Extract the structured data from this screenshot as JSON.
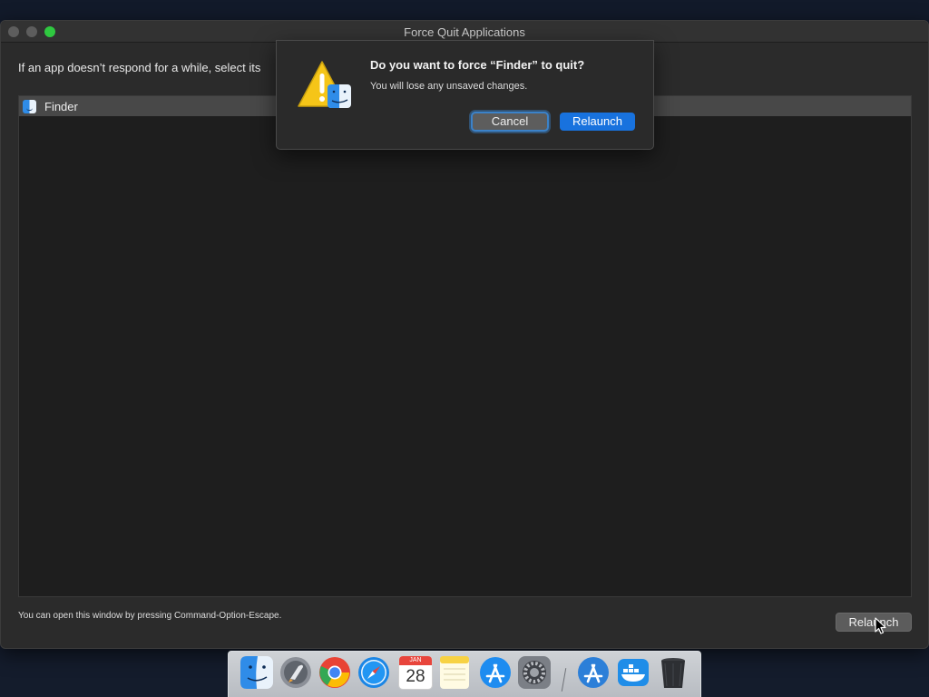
{
  "window": {
    "title": "Force Quit Applications"
  },
  "instructions": "If an app doesn’t respond for a while, select its",
  "app_list": {
    "items": [
      {
        "label": "Finder",
        "icon": "finder-icon"
      }
    ]
  },
  "footer": {
    "note": "You can open this window by pressing Command-Option-Escape.",
    "relaunch_label": "Relaunch"
  },
  "alert": {
    "heading": "Do you want to force “Finder” to quit?",
    "message": "You will lose any unsaved changes.",
    "cancel_label": "Cancel",
    "relaunch_label": "Relaunch",
    "icon": "warning-finder-icon"
  },
  "dock": {
    "calendar_month": "JAN",
    "calendar_day": "28",
    "items": [
      "finder-icon",
      "launchpad-icon",
      "chrome-icon",
      "safari-icon",
      "calendar-icon",
      "notes-icon",
      "app-store-icon",
      "system-preferences-icon",
      "app-store-downloads-icon",
      "docker-icon",
      "trash-icon"
    ]
  },
  "colors": {
    "accent_blue": "#1872de",
    "zoom_green": "#2fc840",
    "warning_yellow": "#f5c518"
  }
}
